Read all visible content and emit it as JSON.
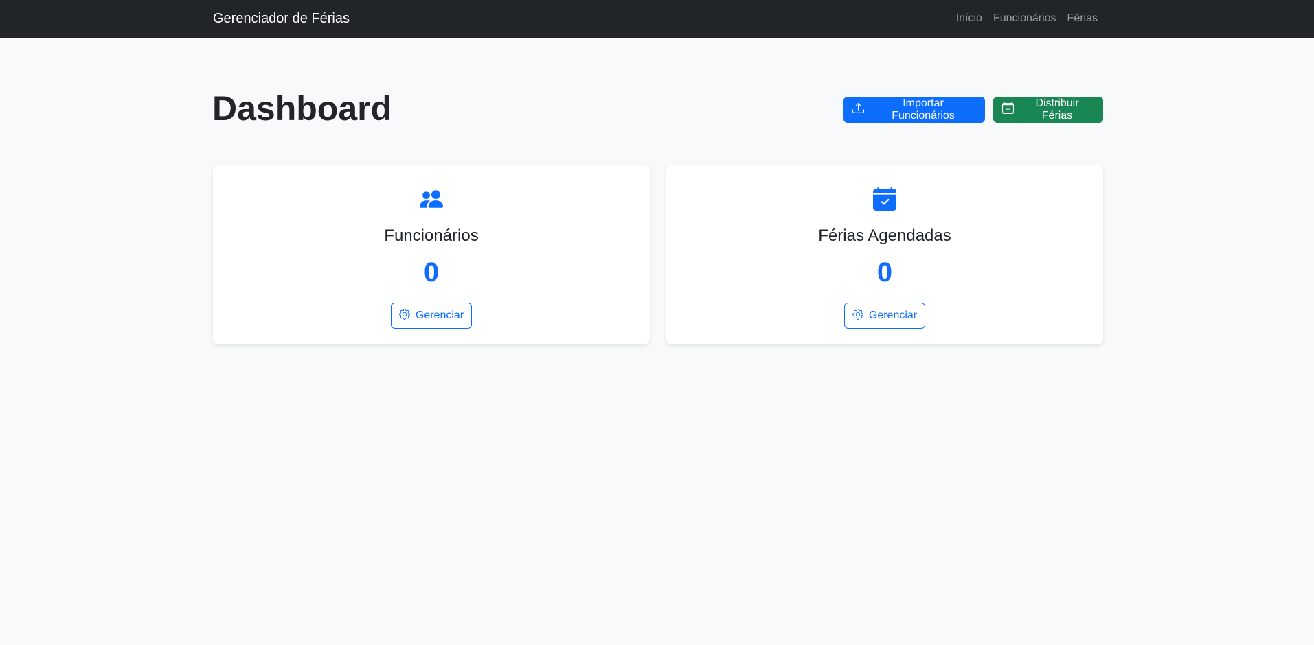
{
  "navbar": {
    "brand": "Gerenciador de Férias",
    "links": [
      "Início",
      "Funcionários",
      "Férias"
    ]
  },
  "page": {
    "title": "Dashboard",
    "import_button": "Importar Funcionários",
    "distribute_button": "Distribuir Férias"
  },
  "cards": [
    {
      "icon": "people-icon",
      "title": "Funcionários",
      "count": "0",
      "button": "Gerenciar",
      "button_icon": "gear-icon"
    },
    {
      "icon": "calendar-check-icon",
      "title": "Férias Agendadas",
      "count": "0",
      "button": "Gerenciar",
      "button_icon": "gear-icon"
    }
  ],
  "colors": {
    "navbar": "#212529",
    "primary": "#0d6efd",
    "success": "#198754",
    "background": "#f8f9fa"
  }
}
